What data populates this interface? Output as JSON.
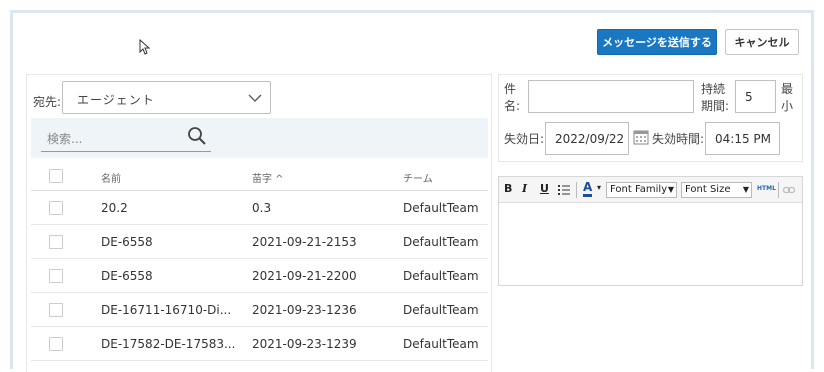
{
  "header": {
    "send_label": "メッセージを送信する",
    "cancel_label": "キャンセル"
  },
  "recipient": {
    "label": "宛先:",
    "selected": "エージェント"
  },
  "search": {
    "placeholder": "検索..."
  },
  "table": {
    "columns": [
      "名前",
      "苗字 ^",
      "チーム"
    ],
    "rows": [
      [
        "20.2",
        "0.3",
        "DefaultTeam"
      ],
      [
        "DE-6558",
        "2021-09-21-2153",
        "DefaultTeam"
      ],
      [
        "DE-6558",
        "2021-09-21-2200",
        "DefaultTeam"
      ],
      [
        "DE-16711-16710-Di...",
        "2021-09-23-1236",
        "DefaultTeam"
      ],
      [
        "DE-17582-DE-17583...",
        "2021-09-23-1239",
        "DefaultTeam"
      ]
    ]
  },
  "form": {
    "subject_label_1": "件",
    "subject_label_2": "名:",
    "subject_value": "",
    "duration_label_1": "持続",
    "duration_label_2": "期間:",
    "duration_value": "5",
    "min_label_1": "最",
    "min_label_2": "小",
    "expiry_date_label": "失効日:",
    "expiry_date_value": "2022/09/22",
    "expiry_time_label": "失効時間:",
    "expiry_time_value": "04:15 PM"
  },
  "editor": {
    "bold": "B",
    "italic": "I",
    "underline": "U",
    "font_color": "A",
    "font_family": "Font Family",
    "font_size": "Font Size",
    "html": "HTML"
  }
}
